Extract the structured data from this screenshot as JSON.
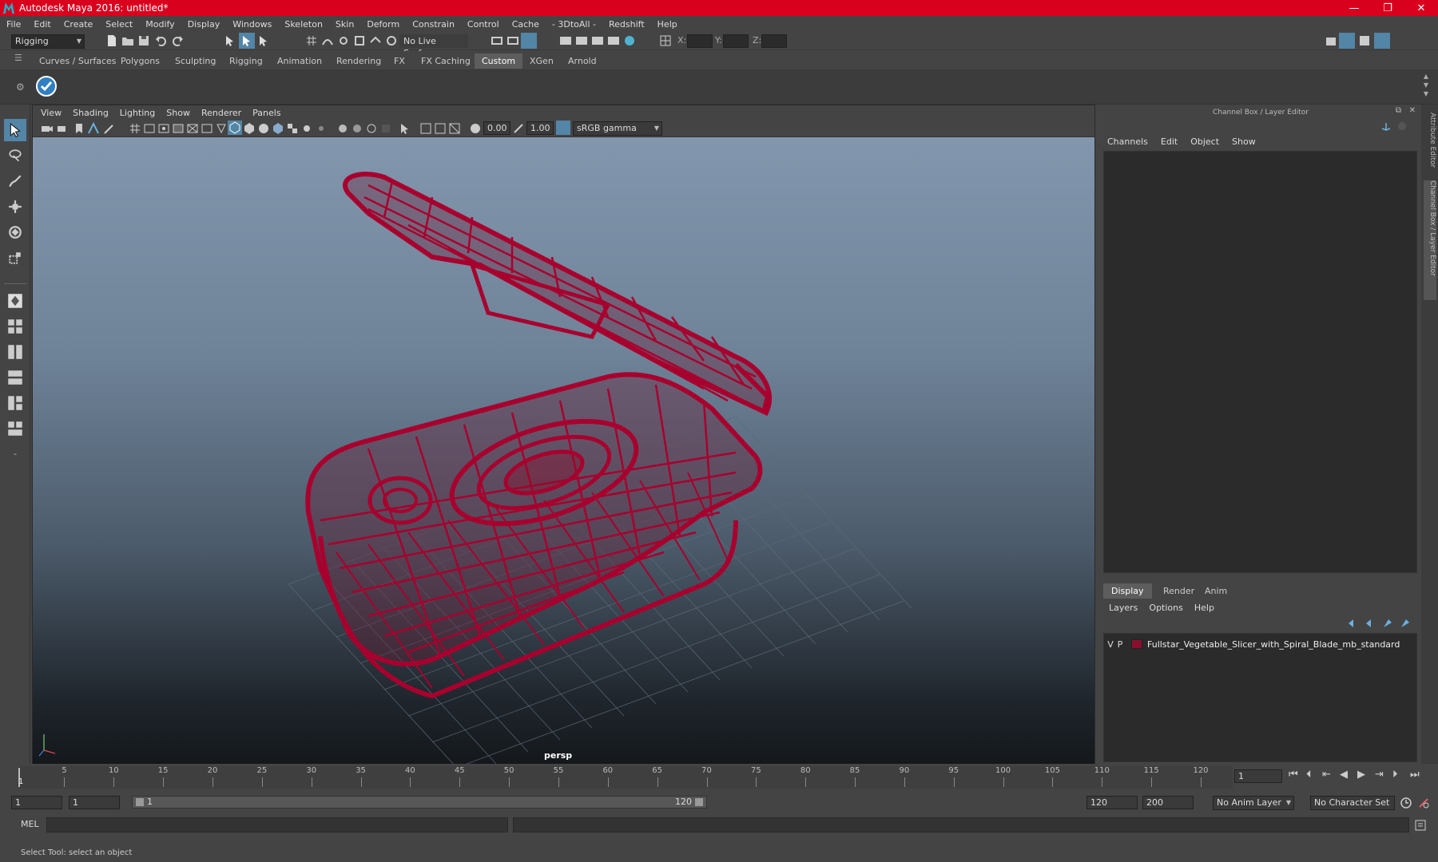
{
  "window": {
    "title": "Autodesk Maya 2016: untitled*",
    "minimize": "—",
    "restore": "❐",
    "close": "✕"
  },
  "menubar": [
    "File",
    "Edit",
    "Create",
    "Select",
    "Modify",
    "Display",
    "Windows",
    "Skeleton",
    "Skin",
    "Deform",
    "Constrain",
    "Control",
    "Cache",
    "- 3DtoAll -",
    "Redshift",
    "Help"
  ],
  "statusline": {
    "menuset": "Rigging",
    "live_surface": "No Live Surface",
    "x_label": "X:",
    "y_label": "Y:",
    "z_label": "Z:"
  },
  "shelf_tabs": [
    "Curves / Surfaces",
    "Polygons",
    "Sculpting",
    "Rigging",
    "Animation",
    "Rendering",
    "FX",
    "FX Caching",
    "Custom",
    "XGen",
    "Arnold"
  ],
  "shelf_active": "Custom",
  "viewport": {
    "menu": [
      "View",
      "Shading",
      "Lighting",
      "Show",
      "Renderer",
      "Panels"
    ],
    "exposure": "0.00",
    "gamma": "1.00",
    "colorspace": "sRGB gamma",
    "camera": "persp"
  },
  "channel_box": {
    "title": "Channel Box / Layer Editor",
    "menu": [
      "Channels",
      "Edit",
      "Object",
      "Show"
    ]
  },
  "layer_editor": {
    "tabs": [
      "Display",
      "Render",
      "Anim"
    ],
    "active_tab": "Display",
    "menu": [
      "Layers",
      "Options",
      "Help"
    ],
    "layers": [
      {
        "v": "V",
        "p": "P",
        "color": "#8a0f2c",
        "name": "Fullstar_Vegetable_Slicer_with_Spiral_Blade_mb_standard"
      }
    ]
  },
  "side_tabs": [
    "Attribute Editor",
    "Channel Box / Layer Editor"
  ],
  "timeline": {
    "ticks": [
      "5",
      "10",
      "15",
      "20",
      "25",
      "30",
      "35",
      "40",
      "45",
      "50",
      "55",
      "60",
      "65",
      "70",
      "75",
      "80",
      "85",
      "90",
      "95",
      "100",
      "105",
      "110",
      "115",
      "120"
    ],
    "start_marker": "1",
    "current_frame": "1"
  },
  "range": {
    "start": "1",
    "playback_start": "1",
    "slider_start": "1",
    "slider_end": "120",
    "playback_end": "120",
    "end": "200",
    "anim_layer": "No Anim Layer",
    "character_set": "No Character Set"
  },
  "command_line": {
    "label": "MEL"
  },
  "help_line": "Select Tool: select an object",
  "colors": {
    "title_bar": "#d9001e",
    "wireframe": "#a8002e",
    "selection": "#5285a6"
  }
}
